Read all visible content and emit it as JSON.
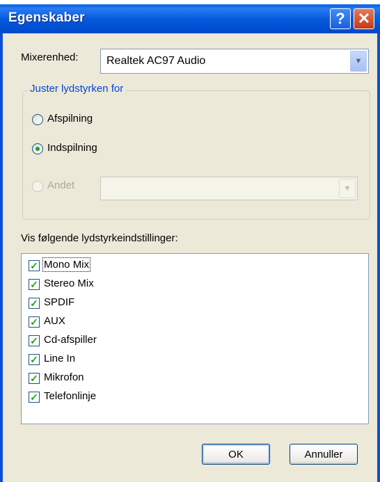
{
  "window": {
    "title": "Egenskaber"
  },
  "mixer": {
    "label": "Mixerenhed:",
    "value": "Realtek AC97 Audio"
  },
  "group": {
    "title": "Juster lydstyrken for",
    "options": [
      {
        "label": "Afspilning",
        "checked": false
      },
      {
        "label": "Indspilning",
        "checked": true
      },
      {
        "label": "Andet",
        "checked": false,
        "disabled": true
      }
    ]
  },
  "list": {
    "label": "Vis følgende lydstyrkeindstillinger:",
    "items": [
      {
        "label": "Mono Mix",
        "checked": true
      },
      {
        "label": "Stereo Mix",
        "checked": true
      },
      {
        "label": "SPDIF",
        "checked": true
      },
      {
        "label": "AUX",
        "checked": true
      },
      {
        "label": "Cd-afspiller",
        "checked": true
      },
      {
        "label": "Line In",
        "checked": true
      },
      {
        "label": "Mikrofon",
        "checked": true
      },
      {
        "label": "Telefonlinje",
        "checked": true
      }
    ]
  },
  "buttons": {
    "ok": "OK",
    "cancel": "Annuller"
  },
  "icons": {
    "help": "help-icon",
    "close": "close-icon",
    "dropdown": "chevron-down-icon",
    "check": "checkmark-icon"
  },
  "colors": {
    "titlebar": "#0a5cde",
    "dialog_bg": "#ece9d8",
    "group_title": "#0046d5",
    "check": "#21a121"
  }
}
